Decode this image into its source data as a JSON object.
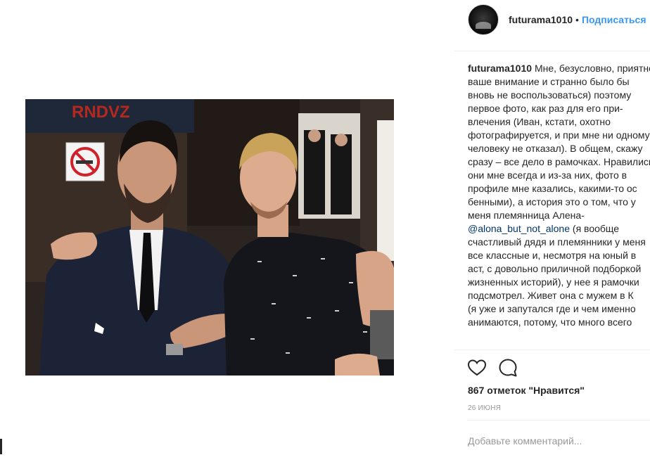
{
  "post": {
    "username": "futurama1010",
    "separator": "•",
    "follow_label": "Подписаться",
    "caption_user": "futurama1010",
    "caption_lines": [
      "Мне, безусловно, приятно",
      "ваше внимание и странно было бы",
      "вновь не воспользоваться) поэтому",
      "первое фото, как раз для его при-",
      "влечения (Иван, кстати, охотно",
      "фотографируется, и при мне ни одному",
      "человеку не отказал). В общем, скажу",
      "сразу – все дело в рамочках. Нравились",
      "они мне всегда и из-за них, фото в",
      "профиле мне казались, какими-то ос",
      "бенными), а история это о том, что у",
      "меня племянница Алена-"
    ],
    "mention": "@alona_but_not_alone",
    "caption_after_mention": " (я вообще",
    "caption_lines_2": [
      "счастливый дядя и племянники у меня",
      "все классные и, несмотря на юный в",
      "аст, с довольно приличной подборкой",
      "жизненных историй), у нее я рамочки",
      "подсмотрел. Живет она с мужем в К",
      "(я уже и запутался где и чем именно",
      "анимаются, потому, что много всего"
    ],
    "likes_text": "867 отметок \"Нравится\"",
    "date_text": "26 июня",
    "comment_placeholder": "Добавьте комментарий...",
    "photo_sign_text": "RNDVZ",
    "icons": {
      "like": "heart-icon",
      "comment": "comment-bubble-icon"
    },
    "colors": {
      "follow": "#3897f0",
      "mention": "#003569",
      "muted": "#999999",
      "text": "#262626"
    }
  }
}
